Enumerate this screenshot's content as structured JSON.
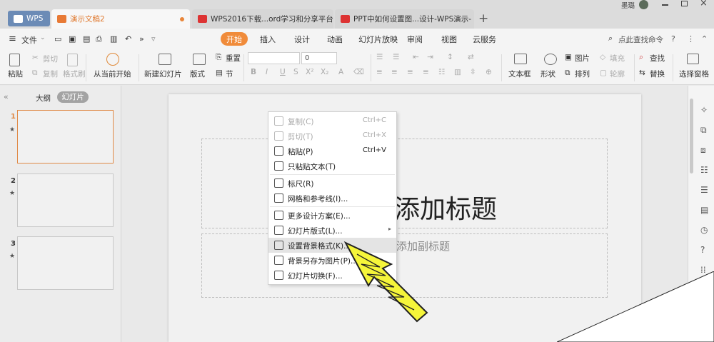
{
  "titlebar": {
    "wps_tab": "WPS",
    "doc_tab": "演示文稿2",
    "tab_a": "WPS2016下载...ord学习和分享平台",
    "tab_b": "PPT中如何设置图...设计-WPS演示-",
    "user": "墨璐"
  },
  "menubar": {
    "file": "文件",
    "tabs": [
      "开始",
      "插入",
      "设计",
      "动画",
      "幻灯片放映",
      "审阅",
      "视图",
      "云服务"
    ],
    "search": "点此查找命令"
  },
  "ribbon": {
    "paste": "粘贴",
    "cut": "剪切",
    "copy": "复制",
    "format_painter": "格式刷",
    "from_current": "从当前开始",
    "new_slide": "新建幻灯片",
    "layout": "版式",
    "reset": "重置",
    "section": "节",
    "font_size": "0",
    "textbox": "文本框",
    "shape": "形状",
    "picture": "图片",
    "arrange": "排列",
    "fill": "填充",
    "outline": "轮廓",
    "find": "查找",
    "replace": "替换",
    "selection_pane": "选择窗格"
  },
  "leftpanel": {
    "outline_tab": "大纲",
    "slides_tab": "幻灯片",
    "slides": [
      {
        "num": "1"
      },
      {
        "num": "2"
      },
      {
        "num": "3"
      }
    ]
  },
  "canvas": {
    "title_text": "单击此处添加标题",
    "title_visible": "添加标题",
    "subtitle_visible": "添加副标题"
  },
  "context_menu": {
    "items": [
      {
        "label": "复制(C)",
        "shortcut": "Ctrl+C"
      },
      {
        "label": "剪切(T)",
        "shortcut": "Ctrl+X"
      },
      {
        "label": "粘贴(P)",
        "shortcut": "Ctrl+V"
      },
      {
        "label": "只粘贴文本(T)",
        "shortcut": ""
      },
      {
        "label": "标尺(R)",
        "shortcut": ""
      },
      {
        "label": "网格和参考线(I)...",
        "shortcut": ""
      },
      {
        "label": "更多设计方案(E)...",
        "shortcut": ""
      },
      {
        "label": "幻灯片版式(L)...",
        "shortcut": ""
      },
      {
        "label": "设置背景格式(K)...",
        "shortcut": ""
      },
      {
        "label": "背景另存为图片(P)...",
        "shortcut": ""
      },
      {
        "label": "幻灯片切换(F)...",
        "shortcut": ""
      }
    ]
  },
  "colors": {
    "accent": "#f08b3a",
    "arrow": "#f5f53a"
  }
}
